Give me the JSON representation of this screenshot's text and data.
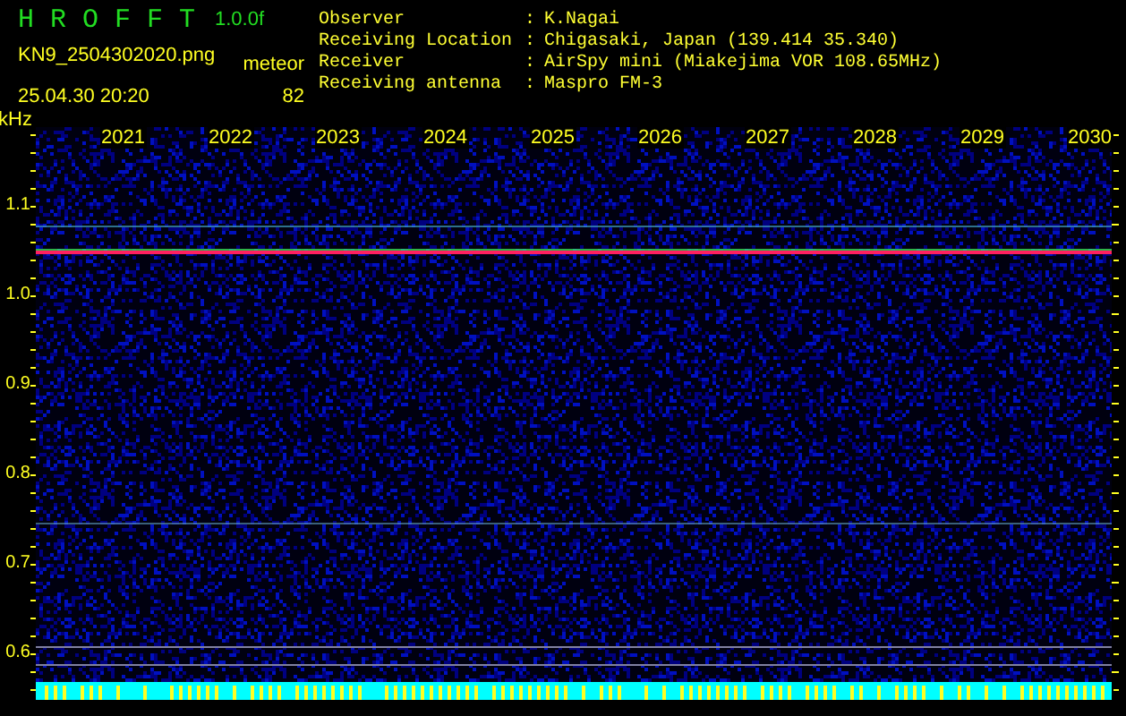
{
  "app": {
    "title": "H R O F F T",
    "version": "1.0.0f",
    "filename": "KN9_2504302020.png",
    "timestamp": "25.04.30 20:20",
    "mode": "meteor",
    "count": "82"
  },
  "info": [
    {
      "label": "Observer",
      "separator": ":",
      "value": "K.Nagai"
    },
    {
      "label": "Receiving Location",
      "separator": ":",
      "value": "Chigasaki, Japan (139.414 35.340)"
    },
    {
      "label": "Receiver",
      "separator": ":",
      "value": "AirSpy mini (Miakejima VOR 108.65MHz)"
    },
    {
      "label": "Receiving antenna",
      "separator": ":",
      "value": "Maspro FM-3"
    }
  ],
  "spectrogram": {
    "y_unit": "kHz",
    "y_labels": [
      "1.1",
      "1.0",
      "0.9",
      "0.8",
      "0.7",
      "0.6"
    ],
    "x_labels": [
      "2021",
      "2022",
      "2023",
      "2024",
      "2025",
      "2026",
      "2027",
      "2028",
      "2029",
      "2030"
    ]
  }
}
